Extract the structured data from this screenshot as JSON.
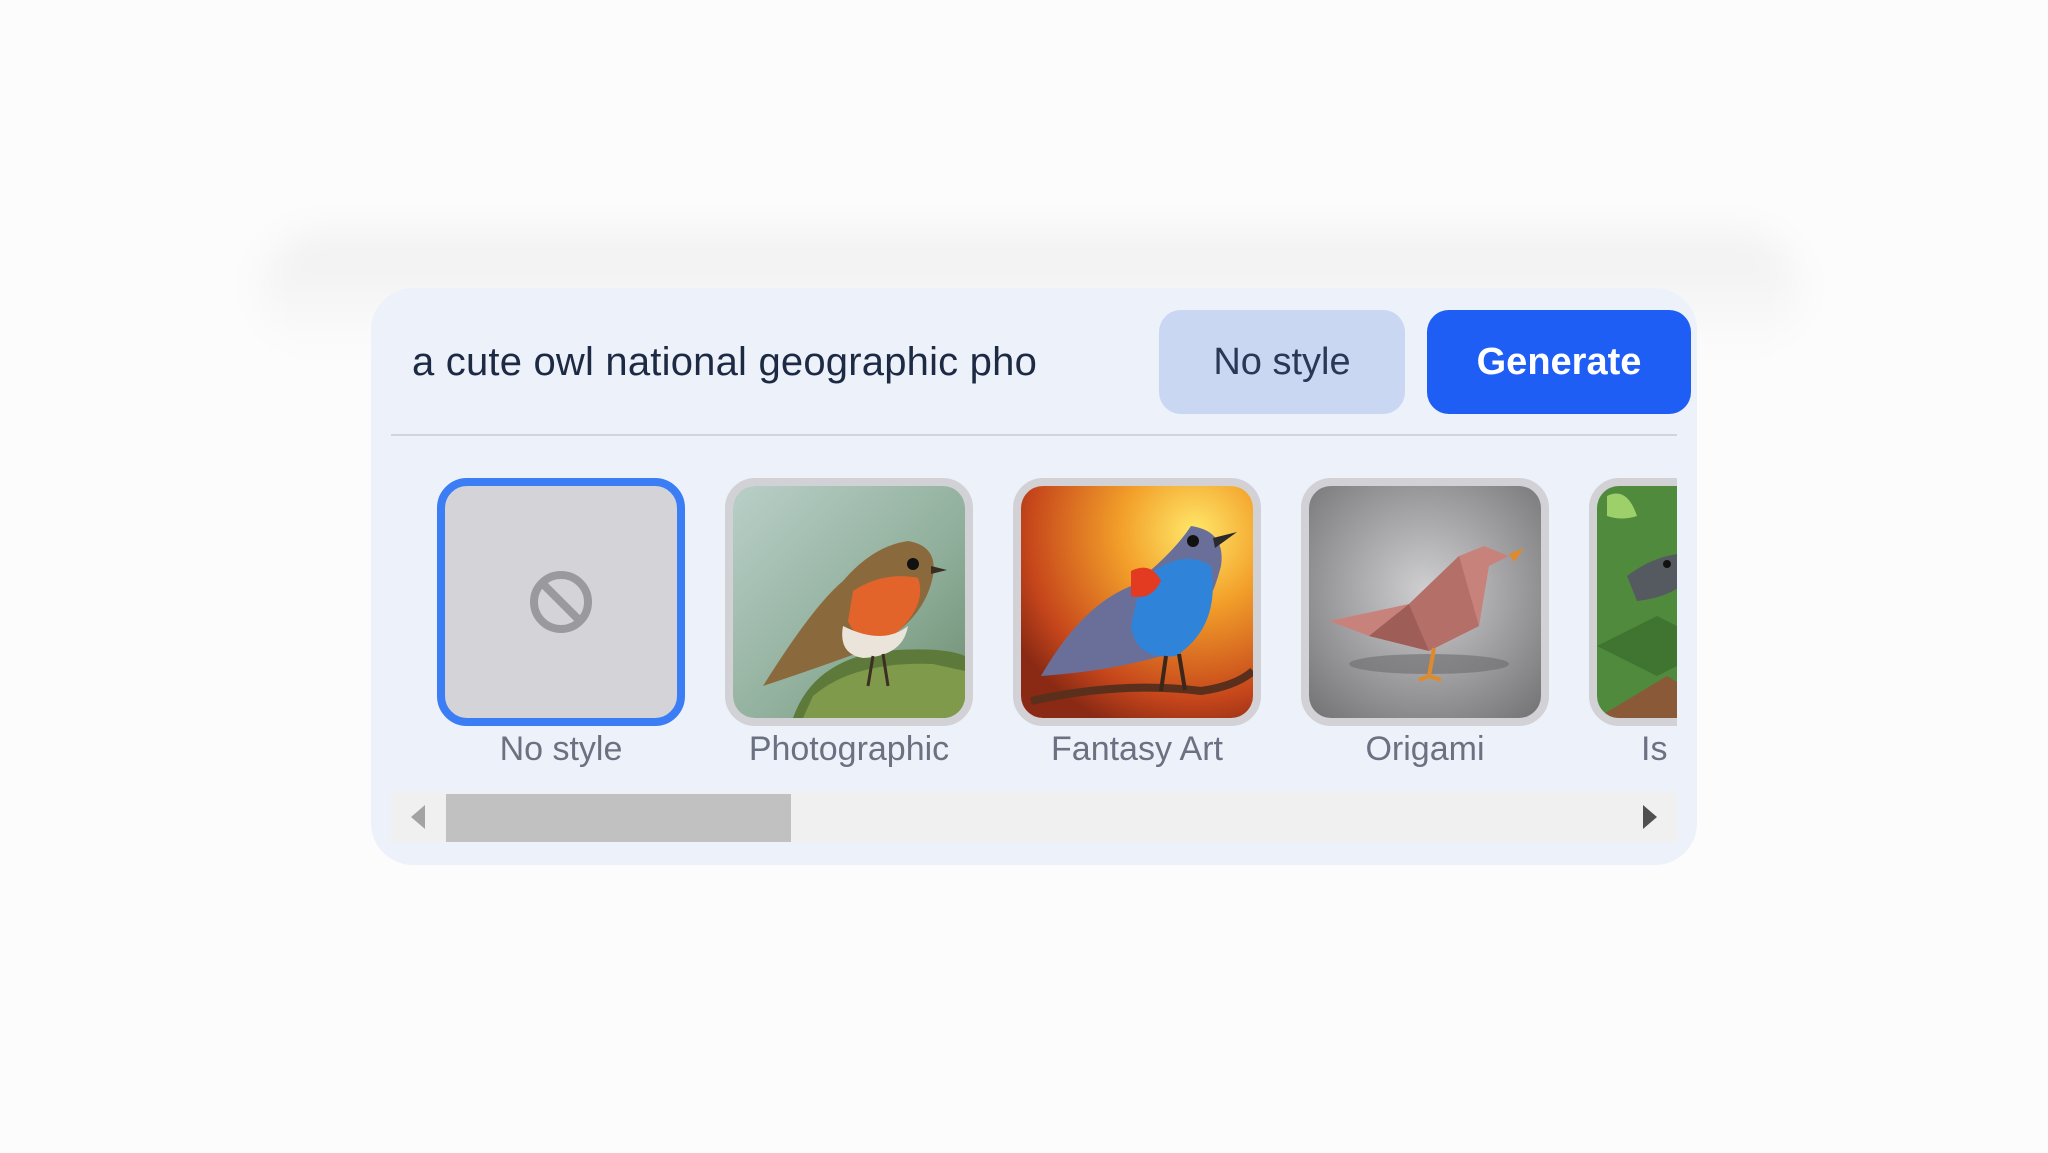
{
  "prompt": {
    "value": "a cute owl national geographic pho"
  },
  "buttons": {
    "style_label": "No style",
    "generate_label": "Generate"
  },
  "styles": [
    {
      "label": "No style",
      "icon": "no-entry-icon",
      "selected": true
    },
    {
      "label": "Photographic",
      "icon": "robin-photo",
      "selected": false
    },
    {
      "label": "Fantasy Art",
      "icon": "fantasy-bird",
      "selected": false
    },
    {
      "label": "Origami",
      "icon": "origami-bird",
      "selected": false
    },
    {
      "label": "Is",
      "icon": "isometric-bird",
      "selected": false
    }
  ],
  "colors": {
    "panel_bg": "#edf1fa",
    "accent": "#1e5ef5",
    "selected_border": "#3a7df5",
    "style_button_bg": "#c9d7f3"
  }
}
